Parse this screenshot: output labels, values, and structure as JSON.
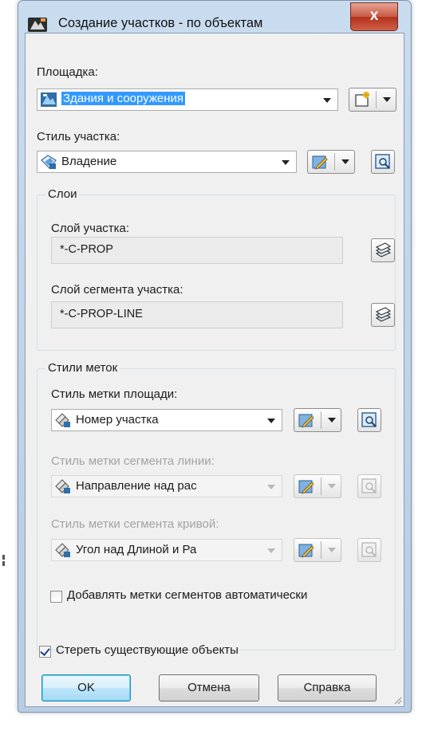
{
  "window": {
    "title": "Создание участков - по объектам",
    "close_glyph": "x"
  },
  "site": {
    "label": "Площадка:",
    "value": "Здания и сооружения",
    "icon": "site-icon"
  },
  "parcel_style": {
    "label": "Стиль участка:",
    "value": "Владение",
    "icon": "parcel-style-icon"
  },
  "layers": {
    "group_label": "Слои",
    "parcel_layer_label": "Слой участка:",
    "parcel_layer_value": "*-C-PROP",
    "segment_layer_label": "Слой сегмента участка:",
    "segment_layer_value": "*-C-PROP-LINE"
  },
  "label_styles": {
    "group_label": "Стили меток",
    "area_label": "Стиль метки площади:",
    "area_value": "Номер участка",
    "line_label": "Стиль метки сегмента линии:",
    "line_value": "Направление над рас",
    "curve_label": "Стиль метки сегмента кривой:",
    "curve_value": "Угол над Длиной и Ра",
    "auto_add_label": "Добавлять метки сегментов автоматически",
    "auto_add_checked": false
  },
  "erase": {
    "label": "Стереть существующие объекты",
    "checked": true
  },
  "buttons": {
    "ok": "OK",
    "cancel": "Отмена",
    "help": "Справка"
  },
  "colors": {
    "selection": "#3399ff",
    "title_gradient": "#c9dcef",
    "close_button": "#c75a44",
    "default_button_border": "#3c7fb1"
  }
}
